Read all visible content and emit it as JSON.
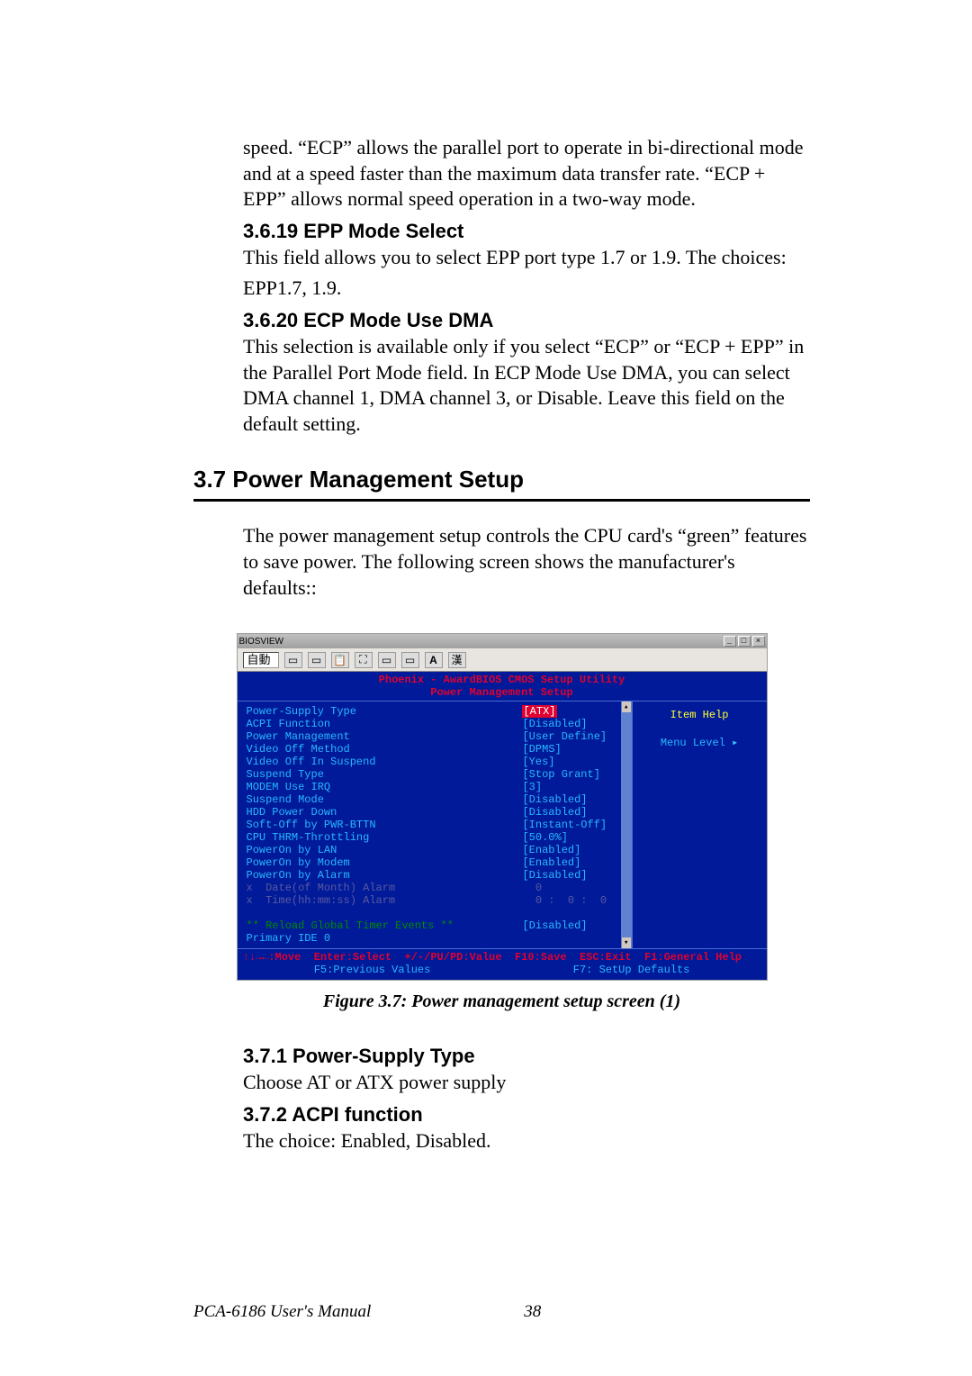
{
  "intro": {
    "p1": "speed. “ECP” allows the parallel port to operate in bi-directional mode and at a speed faster than the maximum data transfer rate. “ECP + EPP” allows normal speed operation in a two-way mode."
  },
  "s3619": {
    "heading": "3.6.19 EPP Mode Select",
    "p1": "This field allows you to select EPP port type 1.7 or 1.9. The choices:\n",
    "p2": "EPP1.7, 1.9."
  },
  "s3620": {
    "heading": "3.6.20 ECP Mode Use DMA",
    "p1": "This selection is available only if you select “ECP” or “ECP + EPP” in the Parallel Port Mode field. In ECP Mode Use DMA, you can select DMA channel 1, DMA channel 3, or Disable. Leave this field on the default setting."
  },
  "s37": {
    "heading": "3.7  Power Management Setup",
    "p1": "The power management setup controls the CPU card's “green” features to save power. The following screen shows the manufacturer's defaults::"
  },
  "bios": {
    "window_title": "BIOSVIEW",
    "toolbar_auto": "自動",
    "toolbar_han": "漢",
    "header1": "Phoenix - AwardBIOS CMOS Setup Utility",
    "header2": "Power Management Setup",
    "itemhelp": "Item Help",
    "menulevel": "Menu Level",
    "arrow": "▸",
    "rows": [
      {
        "label": "Power-Supply Type",
        "value": "[ATX]",
        "selected": true
      },
      {
        "label": "ACPI Function",
        "value": "[Disabled]"
      },
      {
        "label": "Power Management",
        "value": "[User Define]"
      },
      {
        "label": "Video Off Method",
        "value": "[DPMS]"
      },
      {
        "label": "Video Off In Suspend",
        "value": "[Yes]"
      },
      {
        "label": "Suspend Type",
        "value": "[Stop Grant]"
      },
      {
        "label": "MODEM Use IRQ",
        "value": "[3]"
      },
      {
        "label": "Suspend Mode",
        "value": "[Disabled]"
      },
      {
        "label": "HDD Power Down",
        "value": "[Disabled]"
      },
      {
        "label": "Soft-Off by PWR-BTTN",
        "value": "[Instant-Off]"
      },
      {
        "label": "CPU THRM-Throttling",
        "value": "[50.0%]"
      },
      {
        "label": "PowerOn by LAN",
        "value": "[Enabled]"
      },
      {
        "label": "PowerOn by Modem",
        "value": "[Enabled]"
      },
      {
        "label": "PowerOn by Alarm",
        "value": "[Disabled]"
      }
    ],
    "disabled_rows": [
      {
        "label": "x  Date(of Month) Alarm",
        "value": "  0"
      },
      {
        "label": "x  Time(hh:mm:ss) Alarm",
        "value": "  0 :  0 :  0"
      }
    ],
    "events_header": "** Reload Global Timer Events **",
    "events_row": {
      "label": "Primary IDE 0",
      "value": "[Disabled]"
    },
    "footer1": "↑↓→←:Move  Enter:Select  +/-/PU/PD:Value  F10:Save  ESC:Exit  F1:General Help",
    "footer2": "           F5:Previous Values                      F7: SetUp Defaults"
  },
  "figcaption": "Figure 3.7: Power management setup screen (1)",
  "s371": {
    "heading": "3.7.1  Power-Supply Type",
    "p1": "Choose AT or ATX power supply"
  },
  "s372": {
    "heading": "3.7.2 ACPI function",
    "p1": "The choice: Enabled, Disabled."
  },
  "footer": {
    "manual": "PCA-6186 User's Manual",
    "page": "38"
  }
}
